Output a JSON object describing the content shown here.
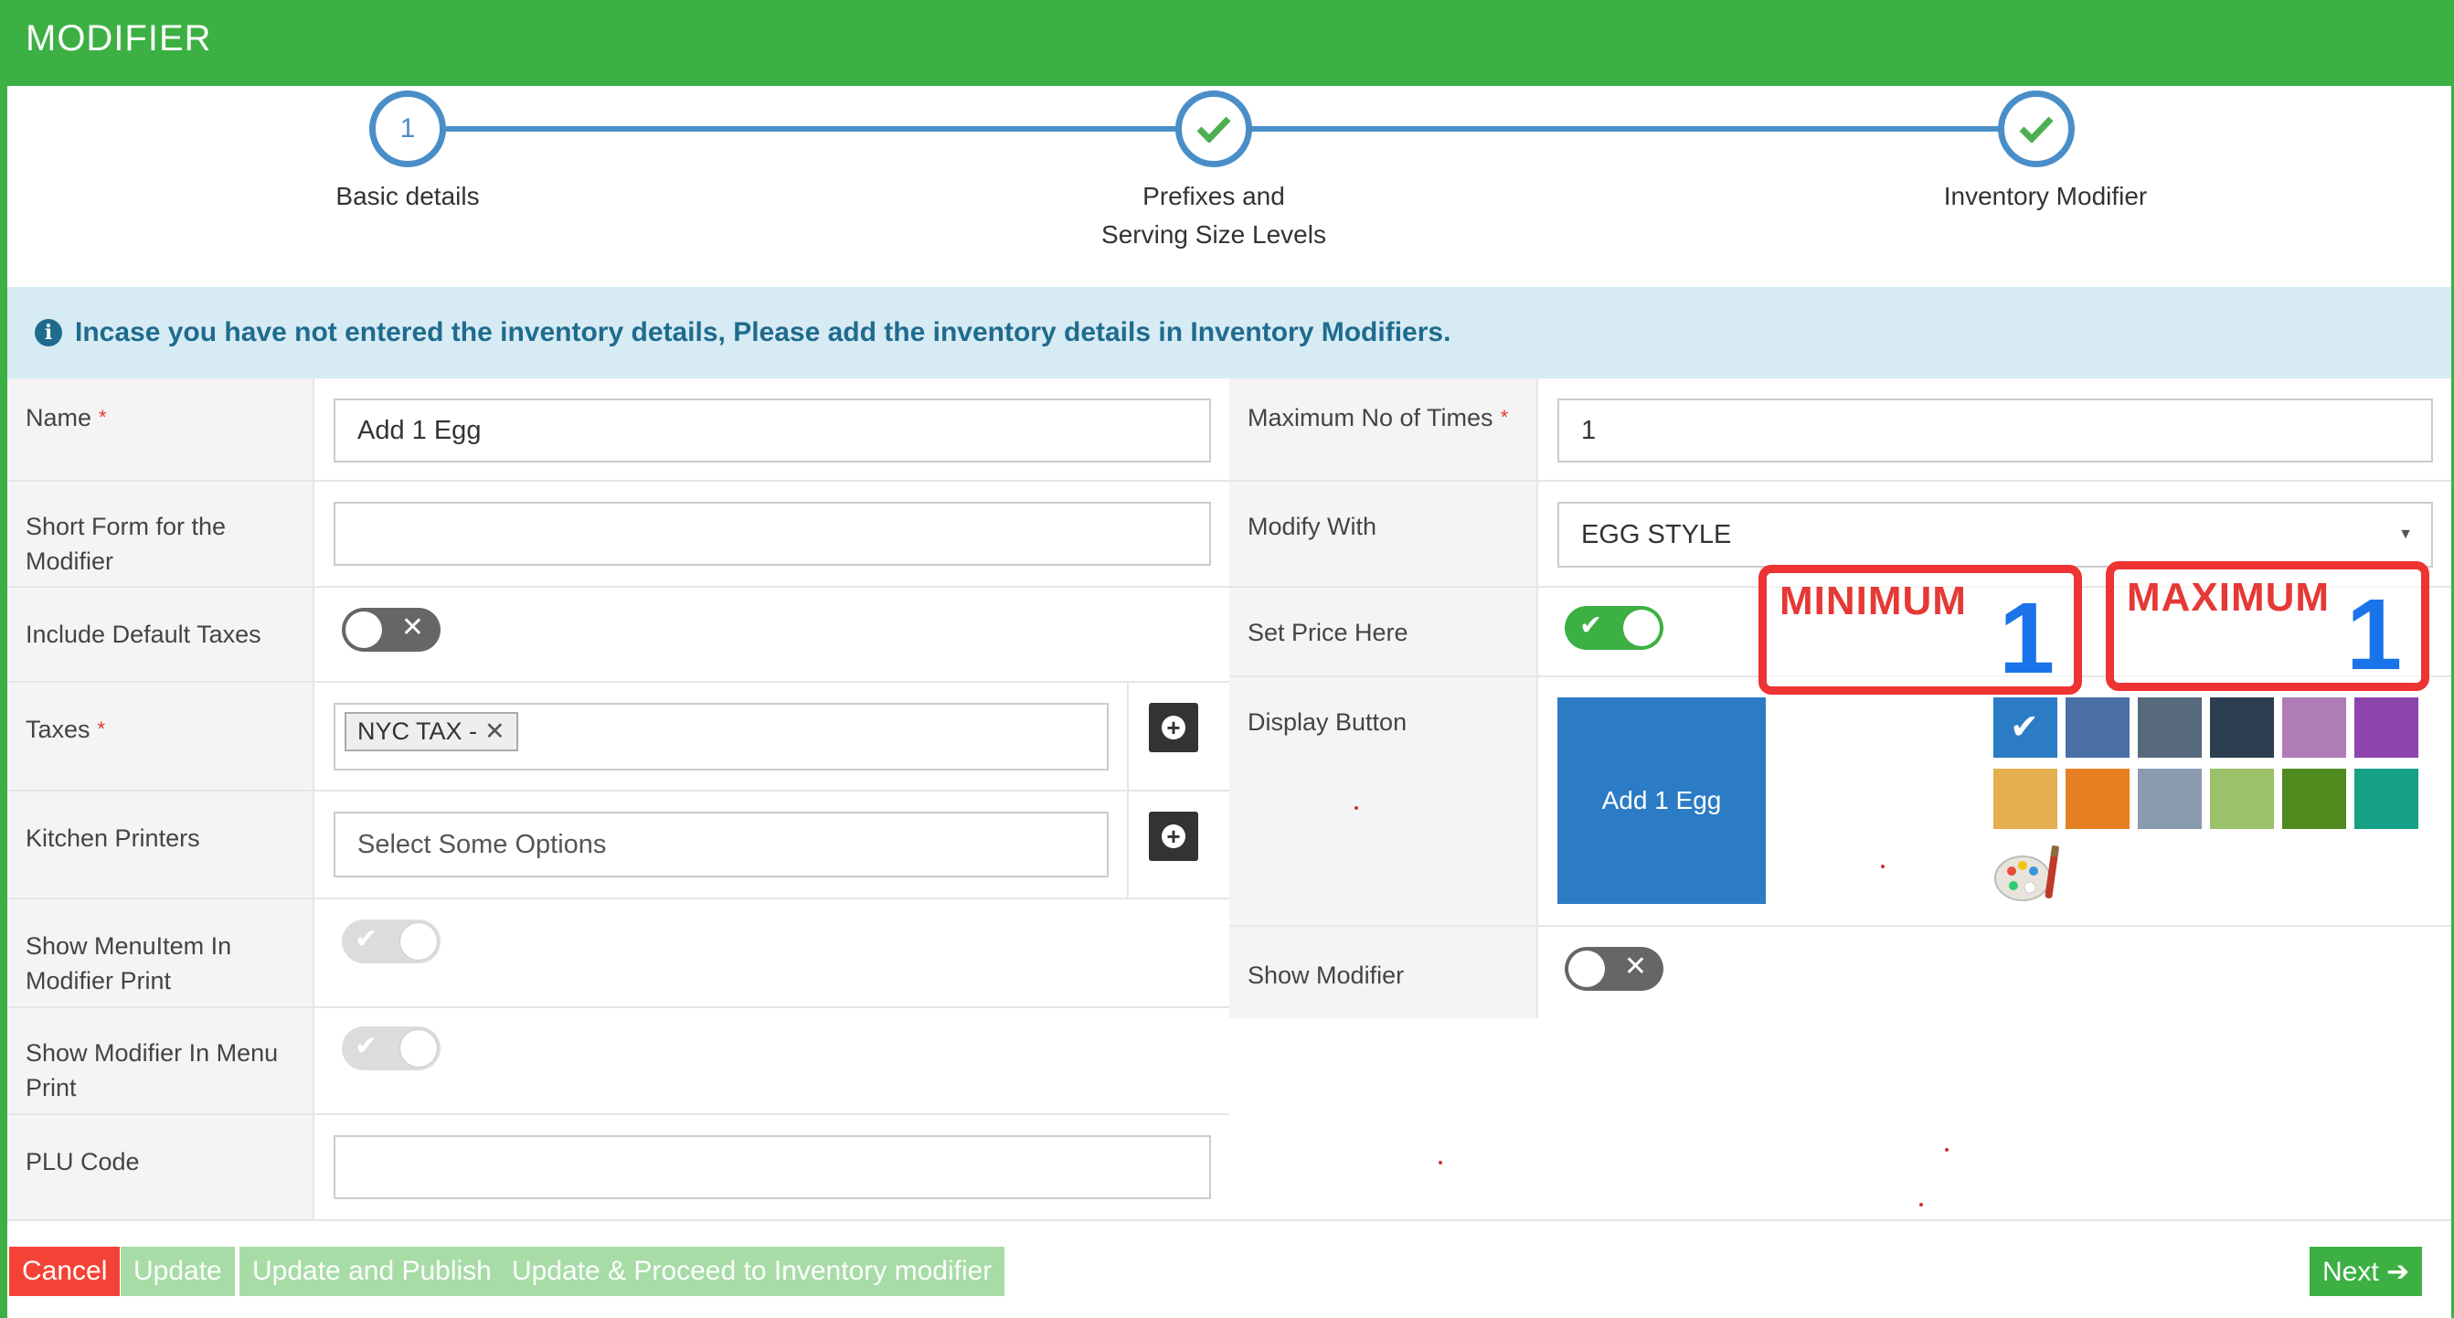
{
  "header": {
    "title": "MODIFIER"
  },
  "stepper": {
    "steps": [
      {
        "number": "1",
        "label": "Basic details",
        "state": "current"
      },
      {
        "label_line1": "Prefixes and",
        "label_line2": "Serving Size Levels",
        "state": "done"
      },
      {
        "label": "Inventory Modifier",
        "state": "done"
      }
    ]
  },
  "info": {
    "text": "Incase you have not entered the inventory details, Please add the inventory details in Inventory Modifiers."
  },
  "left_form": {
    "name": {
      "label": "Name",
      "value": "Add 1 Egg",
      "required": "*"
    },
    "short_form": {
      "label_line1": "Short Form for the",
      "label_line2": "Modifier",
      "value": ""
    },
    "include_default_taxes": {
      "label": "Include Default Taxes"
    },
    "taxes": {
      "label": "Taxes",
      "required": "*",
      "tag": "NYC TAX -",
      "tag_remove": "✕"
    },
    "kitchen_printers": {
      "label": "Kitchen Printers",
      "placeholder": "Select Some Options"
    },
    "show_menuitem": {
      "label_line1": "Show MenuItem In",
      "label_line2": "Modifier Print"
    },
    "show_modifier_menu": {
      "label_line1": "Show Modifier In Menu",
      "label_line2": "Print"
    },
    "plu_code": {
      "label": "PLU Code",
      "value": ""
    }
  },
  "right_form": {
    "max_times": {
      "label": "Maximum No of Times",
      "required": "*",
      "value": "1"
    },
    "modify_with": {
      "label": "Modify With",
      "value": "EGG STYLE",
      "arrow": "▼"
    },
    "set_price": {
      "label": "Set Price Here"
    },
    "display_button": {
      "label": "Display Button",
      "preview_text": "Add 1 Egg"
    },
    "show_modifier": {
      "label": "Show Modifier"
    }
  },
  "swatches": {
    "row1": [
      "#2b7cc4",
      "#4a6fa5",
      "#56697d",
      "#2c3e50",
      "#b07cb5",
      "#8e44ad"
    ],
    "row2": [
      "#e5b04f",
      "#e67e22",
      "#8a9bb0",
      "#9bc16a",
      "#4f8a1e",
      "#16a085"
    ]
  },
  "annotations": {
    "min": {
      "label": "MINIMUM",
      "value": "1"
    },
    "max": {
      "label": "MAXIMUM",
      "value": "1"
    }
  },
  "footer": {
    "cancel": "Cancel",
    "update": "Update",
    "update_publish": "Update and Publish",
    "update_proceed": "Update & Proceed to Inventory modifier",
    "next": "Next ➔"
  },
  "colors": {
    "brand_green": "#3cb043",
    "step_blue": "#4a8ec8",
    "info_bg": "#d6ebf4",
    "info_text": "#1f6b8e",
    "cancel_red": "#f44336"
  }
}
